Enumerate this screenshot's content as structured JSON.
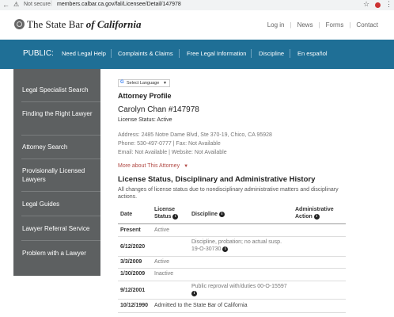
{
  "browser": {
    "warning_icon": "warning-triangle-icon",
    "not_secure": "Not secure",
    "url": "members.calbar.ca.gov/fal/Licensee/Detail/147978"
  },
  "brand": {
    "name_prefix": "The State Bar",
    "name_italic": "of California",
    "top_links": [
      "Log in",
      "News",
      "Forms",
      "Contact"
    ]
  },
  "nav": {
    "public_label": "PUBLIC:",
    "items": [
      "Need Legal Help",
      "Complaints & Claims",
      "Free Legal Information",
      "Discipline",
      "En español"
    ],
    "bg_color": "#1f6f96"
  },
  "sidebar": {
    "items": [
      "Legal Specialist Search",
      "Finding the Right Lawyer",
      "Attorney Search",
      "Provisionally Licensed Lawyers",
      "Legal Guides",
      "Lawyer Referral Service",
      "Problem with a Lawyer"
    ],
    "bg_color": "#5d6061"
  },
  "translate": {
    "label": "Select Language"
  },
  "profile": {
    "heading": "Attorney Profile",
    "name": "Carolyn Chan #147978",
    "license_status": "License Status: Active",
    "address": "Address: 2485 Notre Dame Blvd, Ste 370-19, Chico, CA 95928",
    "phone_fax": "Phone: 530-497-0777  |  Fax: Not Available",
    "email_web": "Email: Not Available  |  Website: Not Available",
    "more_link": "More about This Attorney"
  },
  "history": {
    "heading": "License Status, Disciplinary and Administrative History",
    "description": "All changes of license status due to nondisciplinary administrative matters and disciplinary actions.",
    "col_date": "Date",
    "col_status_l1": "License",
    "col_status_l2": "Status",
    "col_discipline": "Discipline",
    "col_admin_l1": "Administrative",
    "col_admin_l2": "Action",
    "rows": [
      {
        "date": "Present",
        "status": "Active",
        "discipline": ""
      },
      {
        "date": "6/12/2020",
        "status": "",
        "discipline_l1": "Discipline, probation; no actual susp.",
        "discipline_l2": "19-O-30730"
      },
      {
        "date": "3/3/2009",
        "status": "Active",
        "discipline": ""
      },
      {
        "date": "1/30/2009",
        "status": "Inactive",
        "discipline": ""
      },
      {
        "date": "9/12/2001",
        "status": "",
        "discipline_l1": "Public reproval with/duties 00-O-15597"
      },
      {
        "date": "10/12/1990",
        "status": "Admitted to the State Bar of California",
        "discipline": ""
      }
    ]
  }
}
